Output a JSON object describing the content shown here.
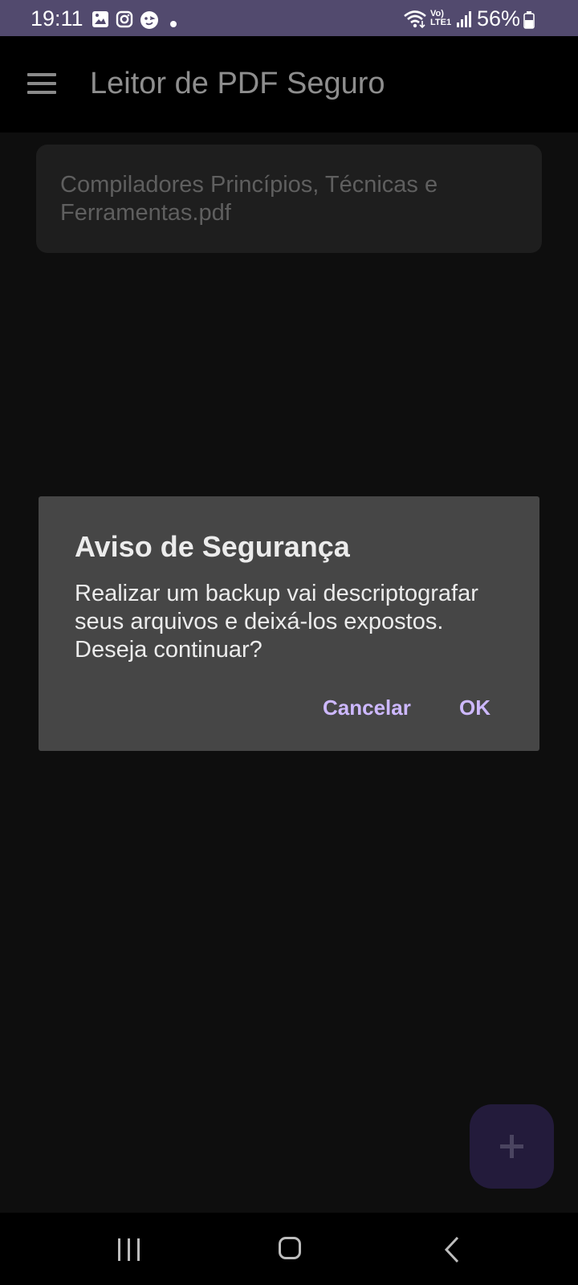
{
  "status_bar": {
    "time": "19:11",
    "battery": "56%",
    "background_color": "#524a6e",
    "left_icons": [
      "gallery-icon",
      "instagram-icon",
      "face-app-icon",
      "dot-icon"
    ],
    "right_icons": [
      "wifi-icon",
      "volte-lte-icon",
      "signal-icon",
      "battery-icon"
    ],
    "volte_label_top": "Vo)",
    "volte_label_bottom": "LTE1"
  },
  "app_bar": {
    "title": "Leitor de PDF Seguro",
    "menu_icon": "hamburger-menu-icon"
  },
  "files": [
    {
      "name": "Compiladores Princípios, Técnicas e Ferramentas.pdf"
    }
  ],
  "dialog": {
    "title": "Aviso de Segurança",
    "message": "Realizar um backup vai descriptografar seus arquivos e deixá-los expostos. Deseja continuar?",
    "cancel_label": "Cancelar",
    "ok_label": "OK",
    "accent_color": "#cdb8ff",
    "background_color": "#464646"
  },
  "fab": {
    "icon": "plus-icon",
    "background_color": "#231b3b"
  },
  "nav_bar": {
    "icons": [
      "recents-icon",
      "home-icon",
      "back-icon"
    ]
  }
}
